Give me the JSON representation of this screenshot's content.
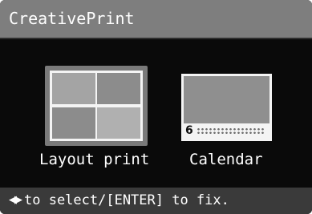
{
  "window": {
    "title": "CreativePrint"
  },
  "menu": {
    "items": [
      {
        "label": "Layout print",
        "icon": "layout-grid-icon",
        "selected": true
      },
      {
        "label": "Calendar",
        "icon": "calendar-icon",
        "selected": false,
        "month_number": "6"
      }
    ]
  },
  "footer": {
    "nav_icon_glyph": "◀▶",
    "hint": "to select/[ENTER] to fix."
  },
  "colors": {
    "title_bar": "#7e7e7e",
    "background": "#0a0a0a",
    "selection_highlight": "#7a7a7a",
    "footer_bar": "#3a3a3a",
    "text": "#ffffff"
  }
}
